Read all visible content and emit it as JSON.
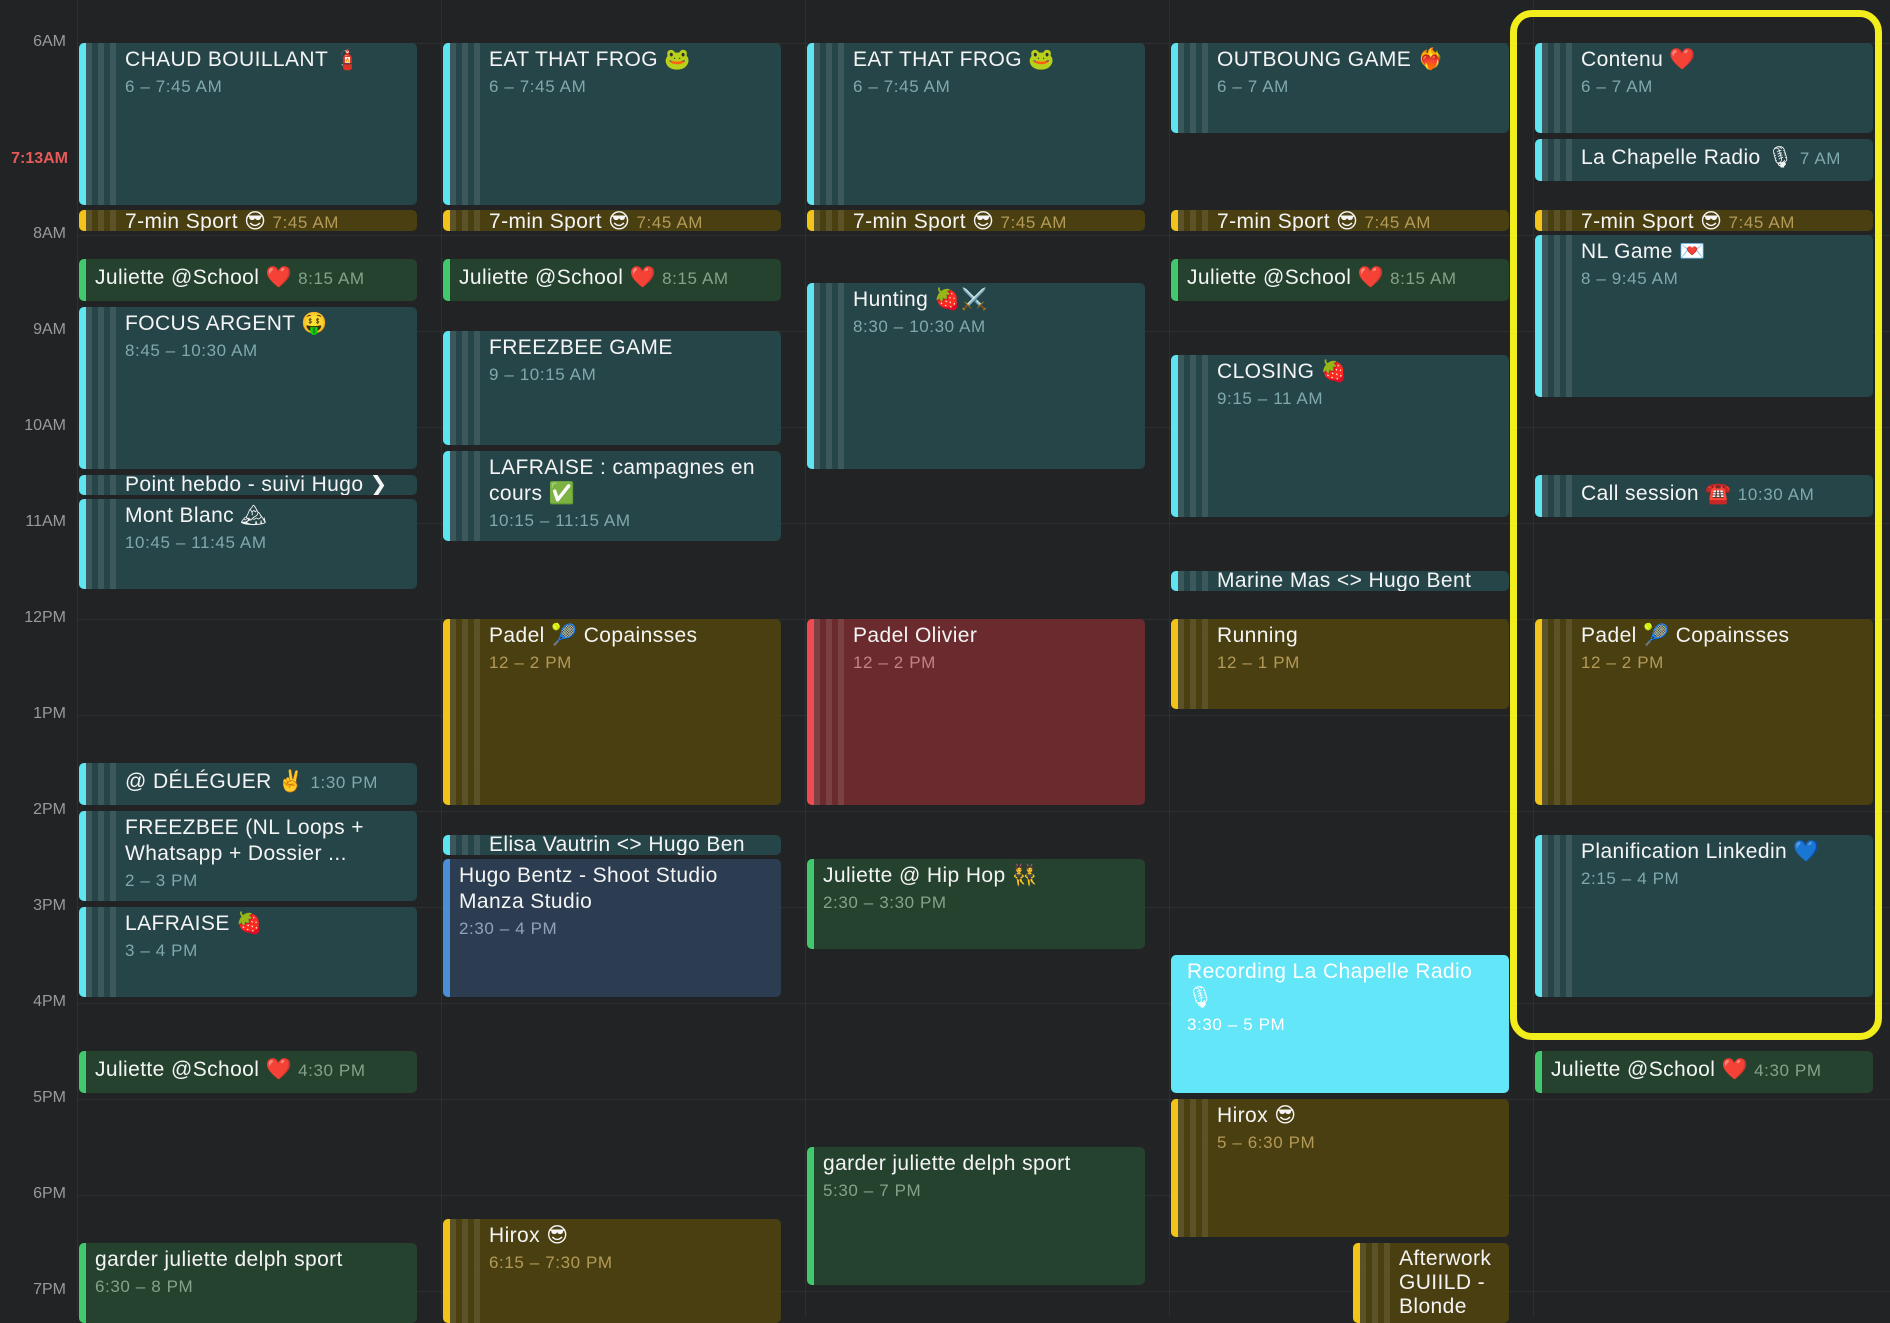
{
  "current_time": "7:13AM",
  "hours": [
    "6AM",
    "8AM",
    "9AM",
    "10AM",
    "11AM",
    "12PM",
    "1PM",
    "2PM",
    "3PM",
    "4PM",
    "5PM",
    "6PM",
    "7PM"
  ],
  "columns": [
    {
      "events": [
        {
          "title": "CHAUD BOUILLANT 🧯",
          "time": "6 – 7:45 AM"
        },
        {
          "title": "7-min Sport 😎",
          "time": "7:45 AM"
        },
        {
          "title": "Juliette @School ❤️",
          "time": "8:15 AM"
        },
        {
          "title": "FOCUS ARGENT 🤑",
          "time": "8:45 – 10:30 AM"
        },
        {
          "title": "Point hebdo - suivi Hugo ❯",
          "time": ""
        },
        {
          "title": "Mont Blanc 🏔",
          "time": "10:45 – 11:45 AM"
        },
        {
          "title": "@ DÉLÉGUER ✌️",
          "time": "1:30 PM"
        },
        {
          "title": "FREEZBEE (NL Loops + Whatsapp + Dossier ...",
          "time": "2 – 3 PM"
        },
        {
          "title": "LAFRAISE 🍓",
          "time": "3 – 4 PM"
        },
        {
          "title": "Juliette @School ❤️",
          "time": "4:30 PM"
        },
        {
          "title": "garder juliette delph sport",
          "time": "6:30 – 8 PM"
        }
      ]
    },
    {
      "events": [
        {
          "title": "EAT THAT FROG 🐸",
          "time": "6 – 7:45 AM"
        },
        {
          "title": "7-min Sport 😎",
          "time": "7:45 AM"
        },
        {
          "title": "Juliette @School ❤️",
          "time": "8:15 AM"
        },
        {
          "title": "FREEZBEE GAME",
          "time": "9 – 10:15 AM"
        },
        {
          "title": "LAFRAISE : campagnes en cours ✅",
          "time": "10:15 – 11:15 AM"
        },
        {
          "title": "Padel 🎾 Copainsses",
          "time": "12 – 2 PM"
        },
        {
          "title": "Elisa Vautrin <> Hugo Ben",
          "time": ""
        },
        {
          "title": "Hugo Bentz - Shoot Studio Manza Studio",
          "time": "2:30 – 4 PM"
        },
        {
          "title": "Hirox 😎",
          "time": "6:15 – 7:30 PM"
        }
      ]
    },
    {
      "events": [
        {
          "title": "EAT THAT FROG 🐸",
          "time": "6 – 7:45 AM"
        },
        {
          "title": "7-min Sport 😎",
          "time": "7:45 AM"
        },
        {
          "title": "Hunting 🍓⚔️",
          "time": "8:30 – 10:30 AM"
        },
        {
          "title": "Padel Olivier",
          "time": "12 – 2 PM"
        },
        {
          "title": "Juliette @ Hip Hop 👯",
          "time": "2:30 – 3:30 PM"
        },
        {
          "title": "garder juliette delph sport",
          "time": "5:30 – 7 PM"
        }
      ]
    },
    {
      "events": [
        {
          "title": "OUTBOUNG GAME ❤️‍🔥",
          "time": "6 – 7 AM"
        },
        {
          "title": "7-min Sport 😎",
          "time": "7:45 AM"
        },
        {
          "title": "Juliette @School ❤️",
          "time": "8:15 AM"
        },
        {
          "title": "CLOSING 🍓",
          "time": "9:15 – 11 AM"
        },
        {
          "title": "Marine Mas <> Hugo Bent",
          "time": ""
        },
        {
          "title": "Running",
          "time": "12 – 1 PM"
        },
        {
          "title": "Recording La Chapelle Radio 🎙",
          "time": "3:30 – 5 PM"
        },
        {
          "title": "Hirox 😎",
          "time": "5 – 6:30 PM"
        },
        {
          "title": "Afterwork GUIILD - Blonde",
          "time": ""
        }
      ]
    },
    {
      "events": [
        {
          "title": "Contenu ❤️",
          "time": "6 – 7 AM"
        },
        {
          "title": "La Chapelle Radio 🎙",
          "time": "7 AM"
        },
        {
          "title": "7-min Sport 😎",
          "time": "7:45 AM"
        },
        {
          "title": "NL Game 💌",
          "time": "8 – 9:45 AM"
        },
        {
          "title": "Call session ☎️",
          "time": "10:30 AM"
        },
        {
          "title": "Padel 🎾 Copainsses",
          "time": "12 – 2 PM"
        },
        {
          "title": "Planification Linkedin 💙",
          "time": "2:15 – 4 PM"
        },
        {
          "title": "Juliette @School ❤️",
          "time": "4:30 PM"
        }
      ]
    }
  ],
  "colors": {
    "highlight": "#f2ee1c",
    "now": "#e85a5a",
    "teal": "#5ee5f2",
    "yellow": "#f2c318",
    "green": "#42c86d",
    "red": "#f04a52",
    "blue": "#4a8fd8"
  }
}
